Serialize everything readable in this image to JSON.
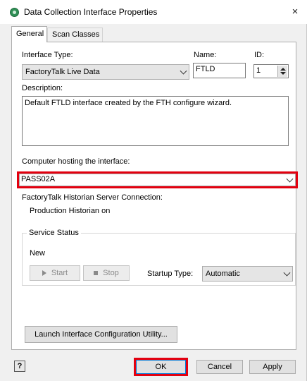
{
  "window": {
    "title": "Data Collection Interface Properties",
    "close_symbol": "×"
  },
  "tabs": [
    {
      "label": "General",
      "active": true
    },
    {
      "label": "Scan Classes",
      "active": false
    }
  ],
  "general": {
    "interface_type_label": "Interface Type:",
    "interface_type_value": "FactoryTalk Live Data",
    "name_label": "Name:",
    "name_value": "FTLD",
    "id_label": "ID:",
    "id_value": "1",
    "description_label": "Description:",
    "description_value": "Default FTLD interface created by the FTH configure wizard.",
    "computer_label": "Computer hosting the interface:",
    "computer_value": "PASS02A",
    "server_connection_label": "FactoryTalk Historian Server Connection:",
    "server_connection_value": "Production Historian on",
    "service_status": {
      "group_label": "Service Status",
      "status_value": "New",
      "start_label": "Start",
      "stop_label": "Stop",
      "startup_type_label": "Startup Type:",
      "startup_type_value": "Automatic"
    },
    "launch_button_label": "Launch Interface Configuration Utility..."
  },
  "footer": {
    "help_symbol": "?",
    "ok_label": "OK",
    "cancel_label": "Cancel",
    "apply_label": "Apply"
  },
  "colors": {
    "highlight": "#e3000f",
    "dialog_bg": "#f0f0f0",
    "panel_bg": "#ffffff"
  }
}
